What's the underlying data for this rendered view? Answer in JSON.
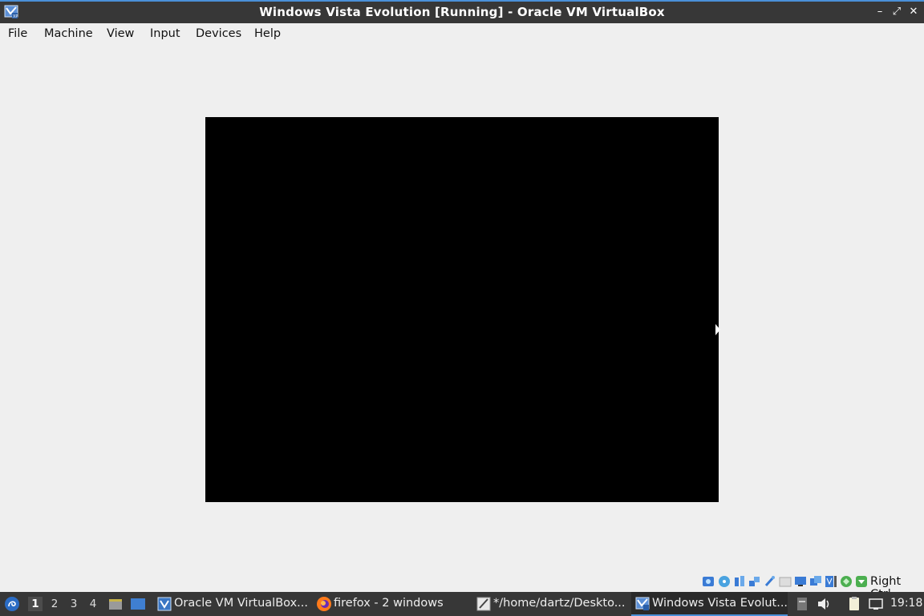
{
  "window": {
    "title": "Windows Vista Evolution [Running] - Oracle VM VirtualBox",
    "minimize": "–",
    "maximize": "⤢",
    "close": "✕"
  },
  "menubar": {
    "items": [
      "File",
      "Machine",
      "View",
      "Input",
      "Devices",
      "Help"
    ]
  },
  "vm_status": {
    "host_key": "Right Ctrl",
    "indicators": [
      "hard-disk",
      "optical-drive",
      "audio",
      "network",
      "usb",
      "shared-folders",
      "display",
      "recording",
      "video-capture",
      "mouse-integration",
      "cpu",
      "arrow"
    ]
  },
  "taskbar": {
    "workspaces": [
      "1",
      "2",
      "3",
      "4"
    ],
    "active_workspace": "1",
    "tasks": [
      {
        "label": "Oracle VM VirtualBox...",
        "icon": "virtualbox-icon",
        "active": false
      },
      {
        "label": "firefox - 2 windows",
        "icon": "firefox-icon",
        "active": false
      },
      {
        "label": "*/home/dartz/Deskto...",
        "icon": "text-editor-icon",
        "active": false
      },
      {
        "label": "Windows Vista Evolut...",
        "icon": "virtualbox-vm-icon",
        "active": true
      }
    ],
    "clock": "19:18"
  },
  "colors": {
    "titlebar": "#373737",
    "accent": "#4a90d9",
    "vm_screen": "#000000",
    "background": "#efefef"
  }
}
